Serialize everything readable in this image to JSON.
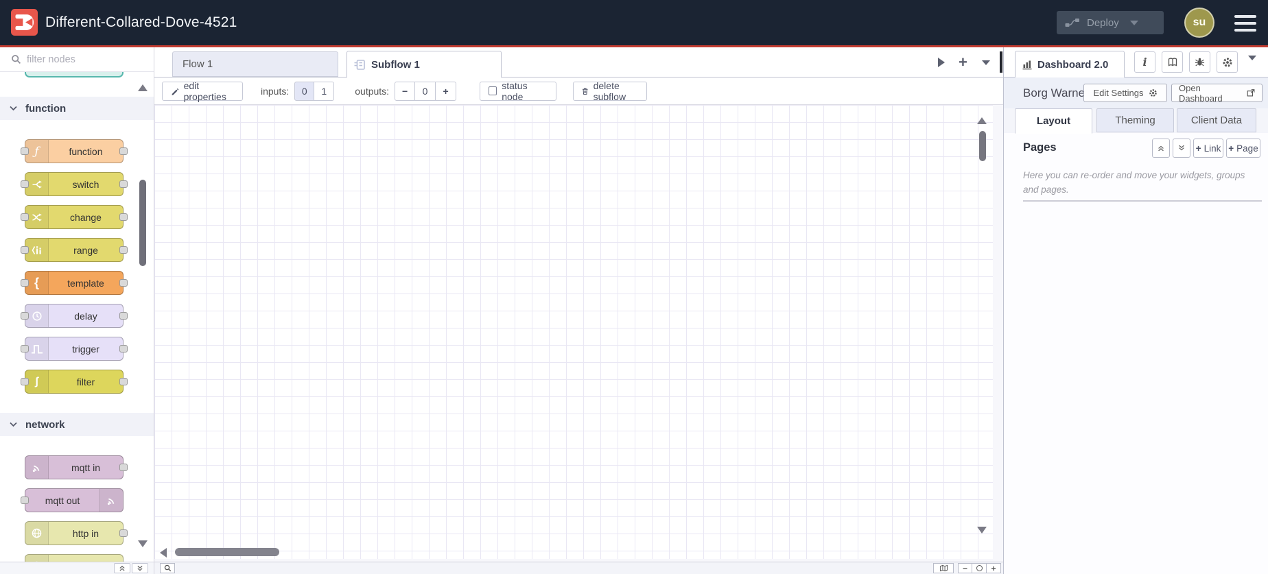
{
  "colors": {
    "brand_red": "#e8564b",
    "header_bg": "#1b2433",
    "header_accent_line": "#c23b31",
    "avatar_bg": "#9e984d",
    "grid_line": "#e9e7f4",
    "active_option_bg": "#e3e6f6"
  },
  "header": {
    "title": "Different-Collared-Dove-4521",
    "deploy_label": "Deploy",
    "avatar_initials": "su"
  },
  "palette": {
    "search_placeholder": "filter nodes",
    "categories": [
      {
        "label": "function",
        "nodes": [
          {
            "label": "function",
            "color": "#fbcfa2",
            "icon": "function",
            "icon_side": "left",
            "ports": "both"
          },
          {
            "label": "switch",
            "color": "#e2d96e",
            "icon": "switch",
            "icon_side": "left",
            "ports": "both"
          },
          {
            "label": "change",
            "color": "#e2d96e",
            "icon": "change",
            "icon_side": "left",
            "ports": "both"
          },
          {
            "label": "range",
            "color": "#e2d96e",
            "icon": "range",
            "icon_side": "left",
            "ports": "both"
          },
          {
            "label": "template",
            "color": "#f4a65c",
            "icon": "template",
            "icon_side": "left",
            "ports": "both"
          },
          {
            "label": "delay",
            "color": "#e6e0f8",
            "icon": "delay",
            "icon_side": "left",
            "ports": "both"
          },
          {
            "label": "trigger",
            "color": "#e6e0f8",
            "icon": "trigger",
            "icon_side": "left",
            "ports": "both"
          },
          {
            "label": "filter",
            "color": "#ddd65c",
            "icon": "filter",
            "icon_side": "left",
            "ports": "both"
          }
        ]
      },
      {
        "label": "network",
        "nodes": [
          {
            "label": "mqtt in",
            "color": "#d8bfd8",
            "icon": "mqtt",
            "icon_side": "left",
            "ports": "right"
          },
          {
            "label": "mqtt out",
            "color": "#d8bfd8",
            "icon": "mqtt",
            "icon_side": "right",
            "ports": "left"
          },
          {
            "label": "http in",
            "color": "#e7e7ae",
            "icon": "globe",
            "icon_side": "left",
            "ports": "right"
          },
          {
            "label": "",
            "color": "#e7e7ae",
            "icon": "globe",
            "icon_side": "left",
            "ports": "right"
          }
        ]
      }
    ]
  },
  "workspace": {
    "tabs": [
      {
        "label": "Flow 1",
        "active": false
      },
      {
        "label": "Subflow 1",
        "active": true,
        "icon": "subflow"
      }
    ],
    "toolbar": {
      "edit_properties": "edit properties",
      "inputs_label": "inputs:",
      "input_options": [
        "0",
        "1"
      ],
      "inputs_selected": "0",
      "outputs_label": "outputs:",
      "outputs_value": "0",
      "status_node": "status node",
      "status_checked": false,
      "delete_subflow": "delete subflow"
    }
  },
  "sidebar": {
    "tab_label": "Dashboard 2.0",
    "app_name": "Borg Warner",
    "edit_settings_label": "Edit Settings",
    "open_dashboard_label": "Open Dashboard",
    "tabs": [
      {
        "label": "Layout",
        "active": true
      },
      {
        "label": "Theming",
        "active": false
      },
      {
        "label": "Client Data",
        "active": false
      }
    ],
    "pages": {
      "heading": "Pages",
      "link_button": "Link",
      "page_button": "Page",
      "helper_text": "Here you can re-order and move your widgets, groups and pages."
    }
  },
  "glyphs": {
    "plus": "+",
    "minus": "−",
    "info": "i",
    "function": "ƒ",
    "template": "{",
    "filter": "ʃ"
  }
}
